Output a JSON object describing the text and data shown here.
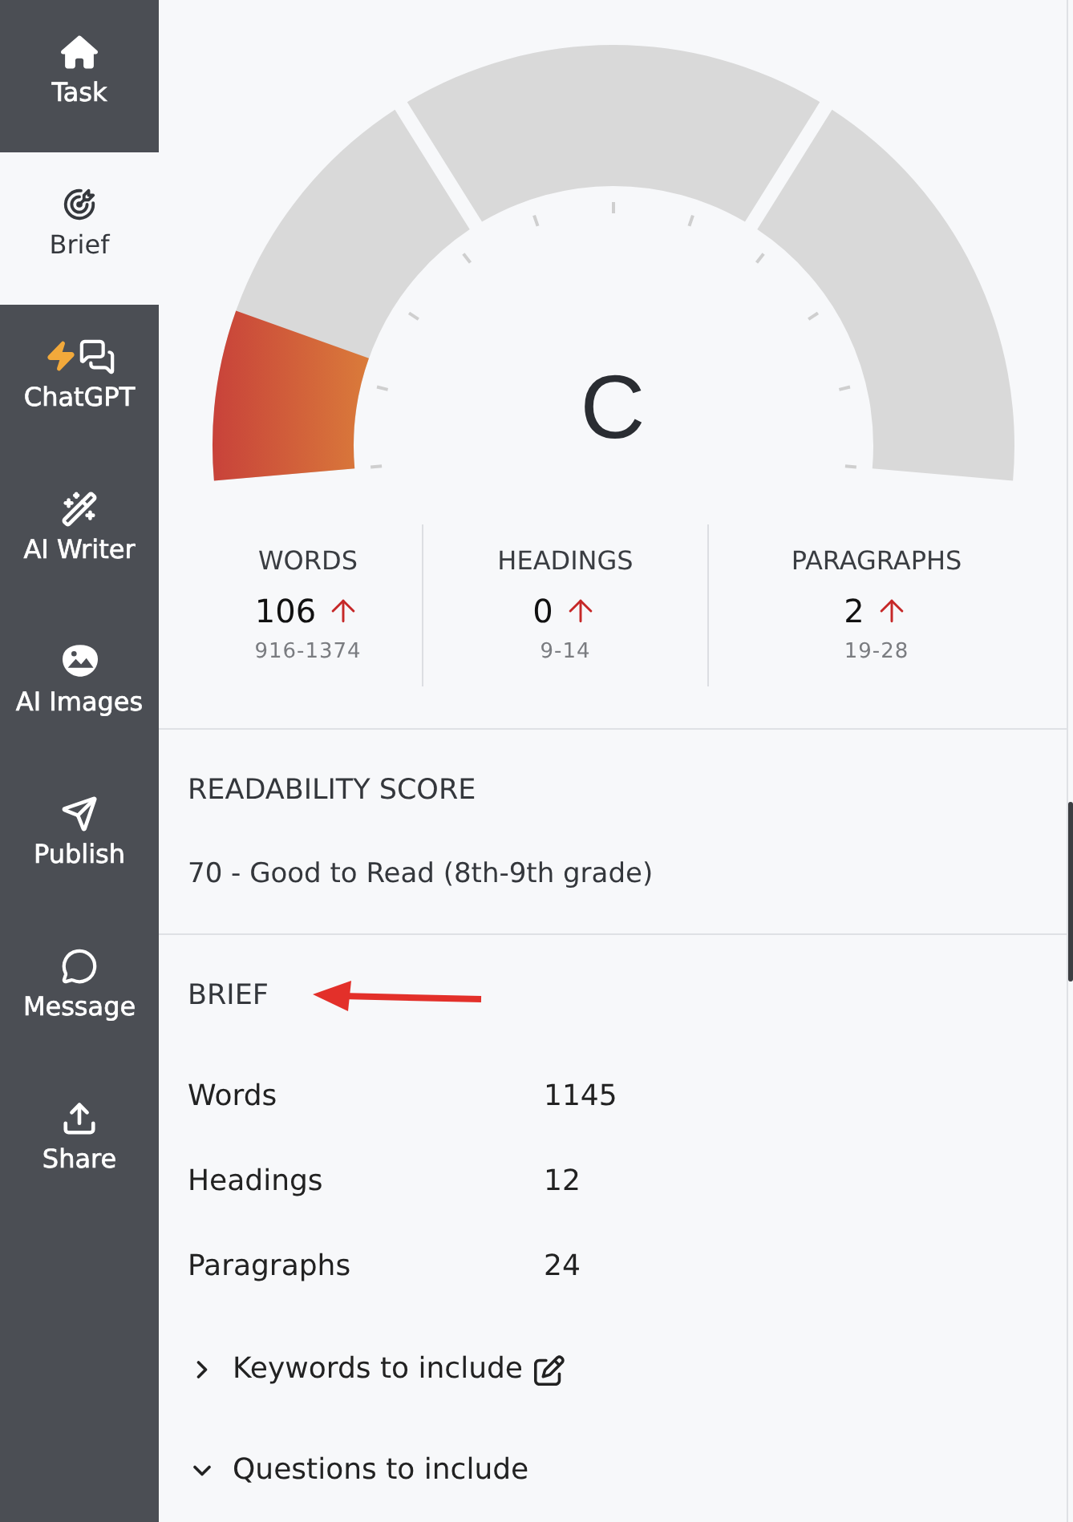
{
  "sidebar": {
    "items": [
      {
        "label": "Task",
        "selected": false
      },
      {
        "label": "Brief",
        "selected": true
      },
      {
        "label": "ChatGPT",
        "selected": false
      },
      {
        "label": "AI Writer",
        "selected": false
      },
      {
        "label": "AI Images",
        "selected": false
      },
      {
        "label": "Publish",
        "selected": false
      },
      {
        "label": "Message",
        "selected": false
      },
      {
        "label": "Share",
        "selected": false
      }
    ]
  },
  "gauge": {
    "grade": "C",
    "level": 0.13
  },
  "stats": [
    {
      "label": "WORDS",
      "value": "106",
      "below_range": true,
      "range": "916-1374"
    },
    {
      "label": "HEADINGS",
      "value": "0",
      "below_range": true,
      "range": "9-14"
    },
    {
      "label": "PARAGRAPHS",
      "value": "2",
      "below_range": true,
      "range": "19-28"
    }
  ],
  "readability": {
    "title": "READABILITY SCORE",
    "text": "70 - Good to Read (8th-9th grade)"
  },
  "brief": {
    "title": "BRIEF",
    "rows": [
      {
        "label": "Words",
        "value": "1145"
      },
      {
        "label": "Headings",
        "value": "12"
      },
      {
        "label": "Paragraphs",
        "value": "24"
      }
    ],
    "sections": [
      {
        "label": "Keywords to include",
        "expanded": false,
        "editable": true
      },
      {
        "label": "Questions to include",
        "expanded": true,
        "editable": false
      }
    ]
  }
}
